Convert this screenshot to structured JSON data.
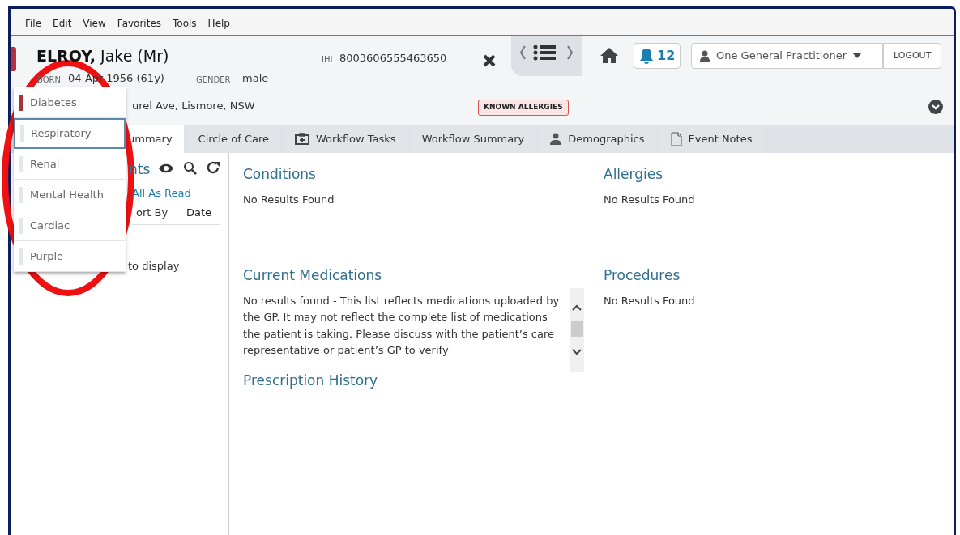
{
  "menu": [
    "File",
    "Edit",
    "View",
    "Favorites",
    "Tools",
    "Help"
  ],
  "patient": {
    "surname": "ELROY,",
    "given": "Jake (Mr)",
    "born_label": "BORN",
    "born": "04-Apr-1956 (61y)",
    "gender_label": "GENDER",
    "gender": "male",
    "ihi_label": "IHI",
    "ihi": "8003606555463650",
    "address": "urel Ave, Lismore, NSW",
    "alert": "KNOWN ALLERGIES"
  },
  "notifications": "12",
  "user": "One General Practitioner",
  "logout": "LOGOUT",
  "tabs": [
    {
      "label": "ummary",
      "selected": true
    },
    {
      "label": "Circle of Care",
      "selected": false
    },
    {
      "label": "Workflow Tasks",
      "selected": false
    },
    {
      "label": "Workflow Summary",
      "selected": false
    },
    {
      "label": "Demographics",
      "selected": false
    },
    {
      "label": "Event Notes",
      "selected": false
    }
  ],
  "left_panel": {
    "title": "nts",
    "mark_read": "All As Read",
    "sort_label": "ort By",
    "sort_value": "Date",
    "empty": "to display"
  },
  "sections": [
    {
      "title": "Conditions",
      "text": "No Results Found",
      "kind": "plain"
    },
    {
      "title": "Allergies",
      "text": "No Results Found",
      "kind": "plain"
    },
    {
      "title": "Current Medications",
      "text": "No results found - This list reflects medications uploaded by the GP. It may not reflect the complete list of medications the patient is taking. Please discuss with the patient’s care representative or patient’s GP to verify",
      "kind": "scrolling"
    },
    {
      "title": "Procedures",
      "text": "No Results Found",
      "kind": "plain"
    },
    {
      "title": "Prescription History",
      "kind": "plain"
    }
  ],
  "dropdown": [
    {
      "label": "Diabetes",
      "color": "#a4343a",
      "selected": false
    },
    {
      "label": "Respiratory",
      "color": "#e3e6ea",
      "selected": true
    },
    {
      "label": "Renal",
      "color": "#e3e6ea",
      "selected": false
    },
    {
      "label": "Mental Health",
      "color": "#e3e6ea",
      "selected": false
    },
    {
      "label": "Cardiac",
      "color": "#e3e6ea",
      "selected": false
    },
    {
      "label": "Purple",
      "color": "#e3e6ea",
      "selected": false
    }
  ]
}
